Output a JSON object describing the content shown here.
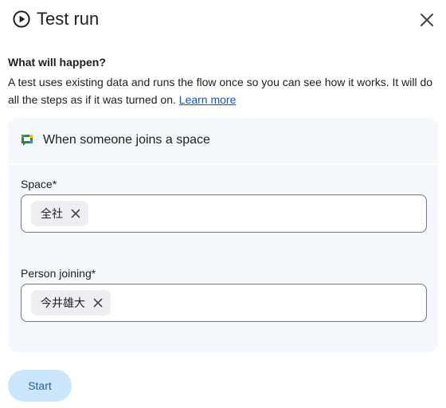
{
  "header": {
    "title": "Test run",
    "icon": "play-circle-icon",
    "close_icon": "close-icon"
  },
  "info": {
    "heading": "What will happen?",
    "text": "A test uses existing data and runs the flow once so you can see how it works. It will do all the steps as if it was turned on.",
    "link_label": "Learn more"
  },
  "trigger": {
    "icon": "google-chat-icon",
    "label": "When someone joins a space"
  },
  "fields": [
    {
      "label": "Space*",
      "chip": "全社"
    },
    {
      "label": "Person joining*",
      "chip": "今井雄大"
    }
  ],
  "start_label": "Start",
  "colors": {
    "accent": "#0b57d0",
    "start_bg": "#cbe6fb",
    "start_text": "#2e5f93",
    "card_bg": "#f4f7fb",
    "chip_bg": "#eceef1",
    "border": "#747775"
  }
}
